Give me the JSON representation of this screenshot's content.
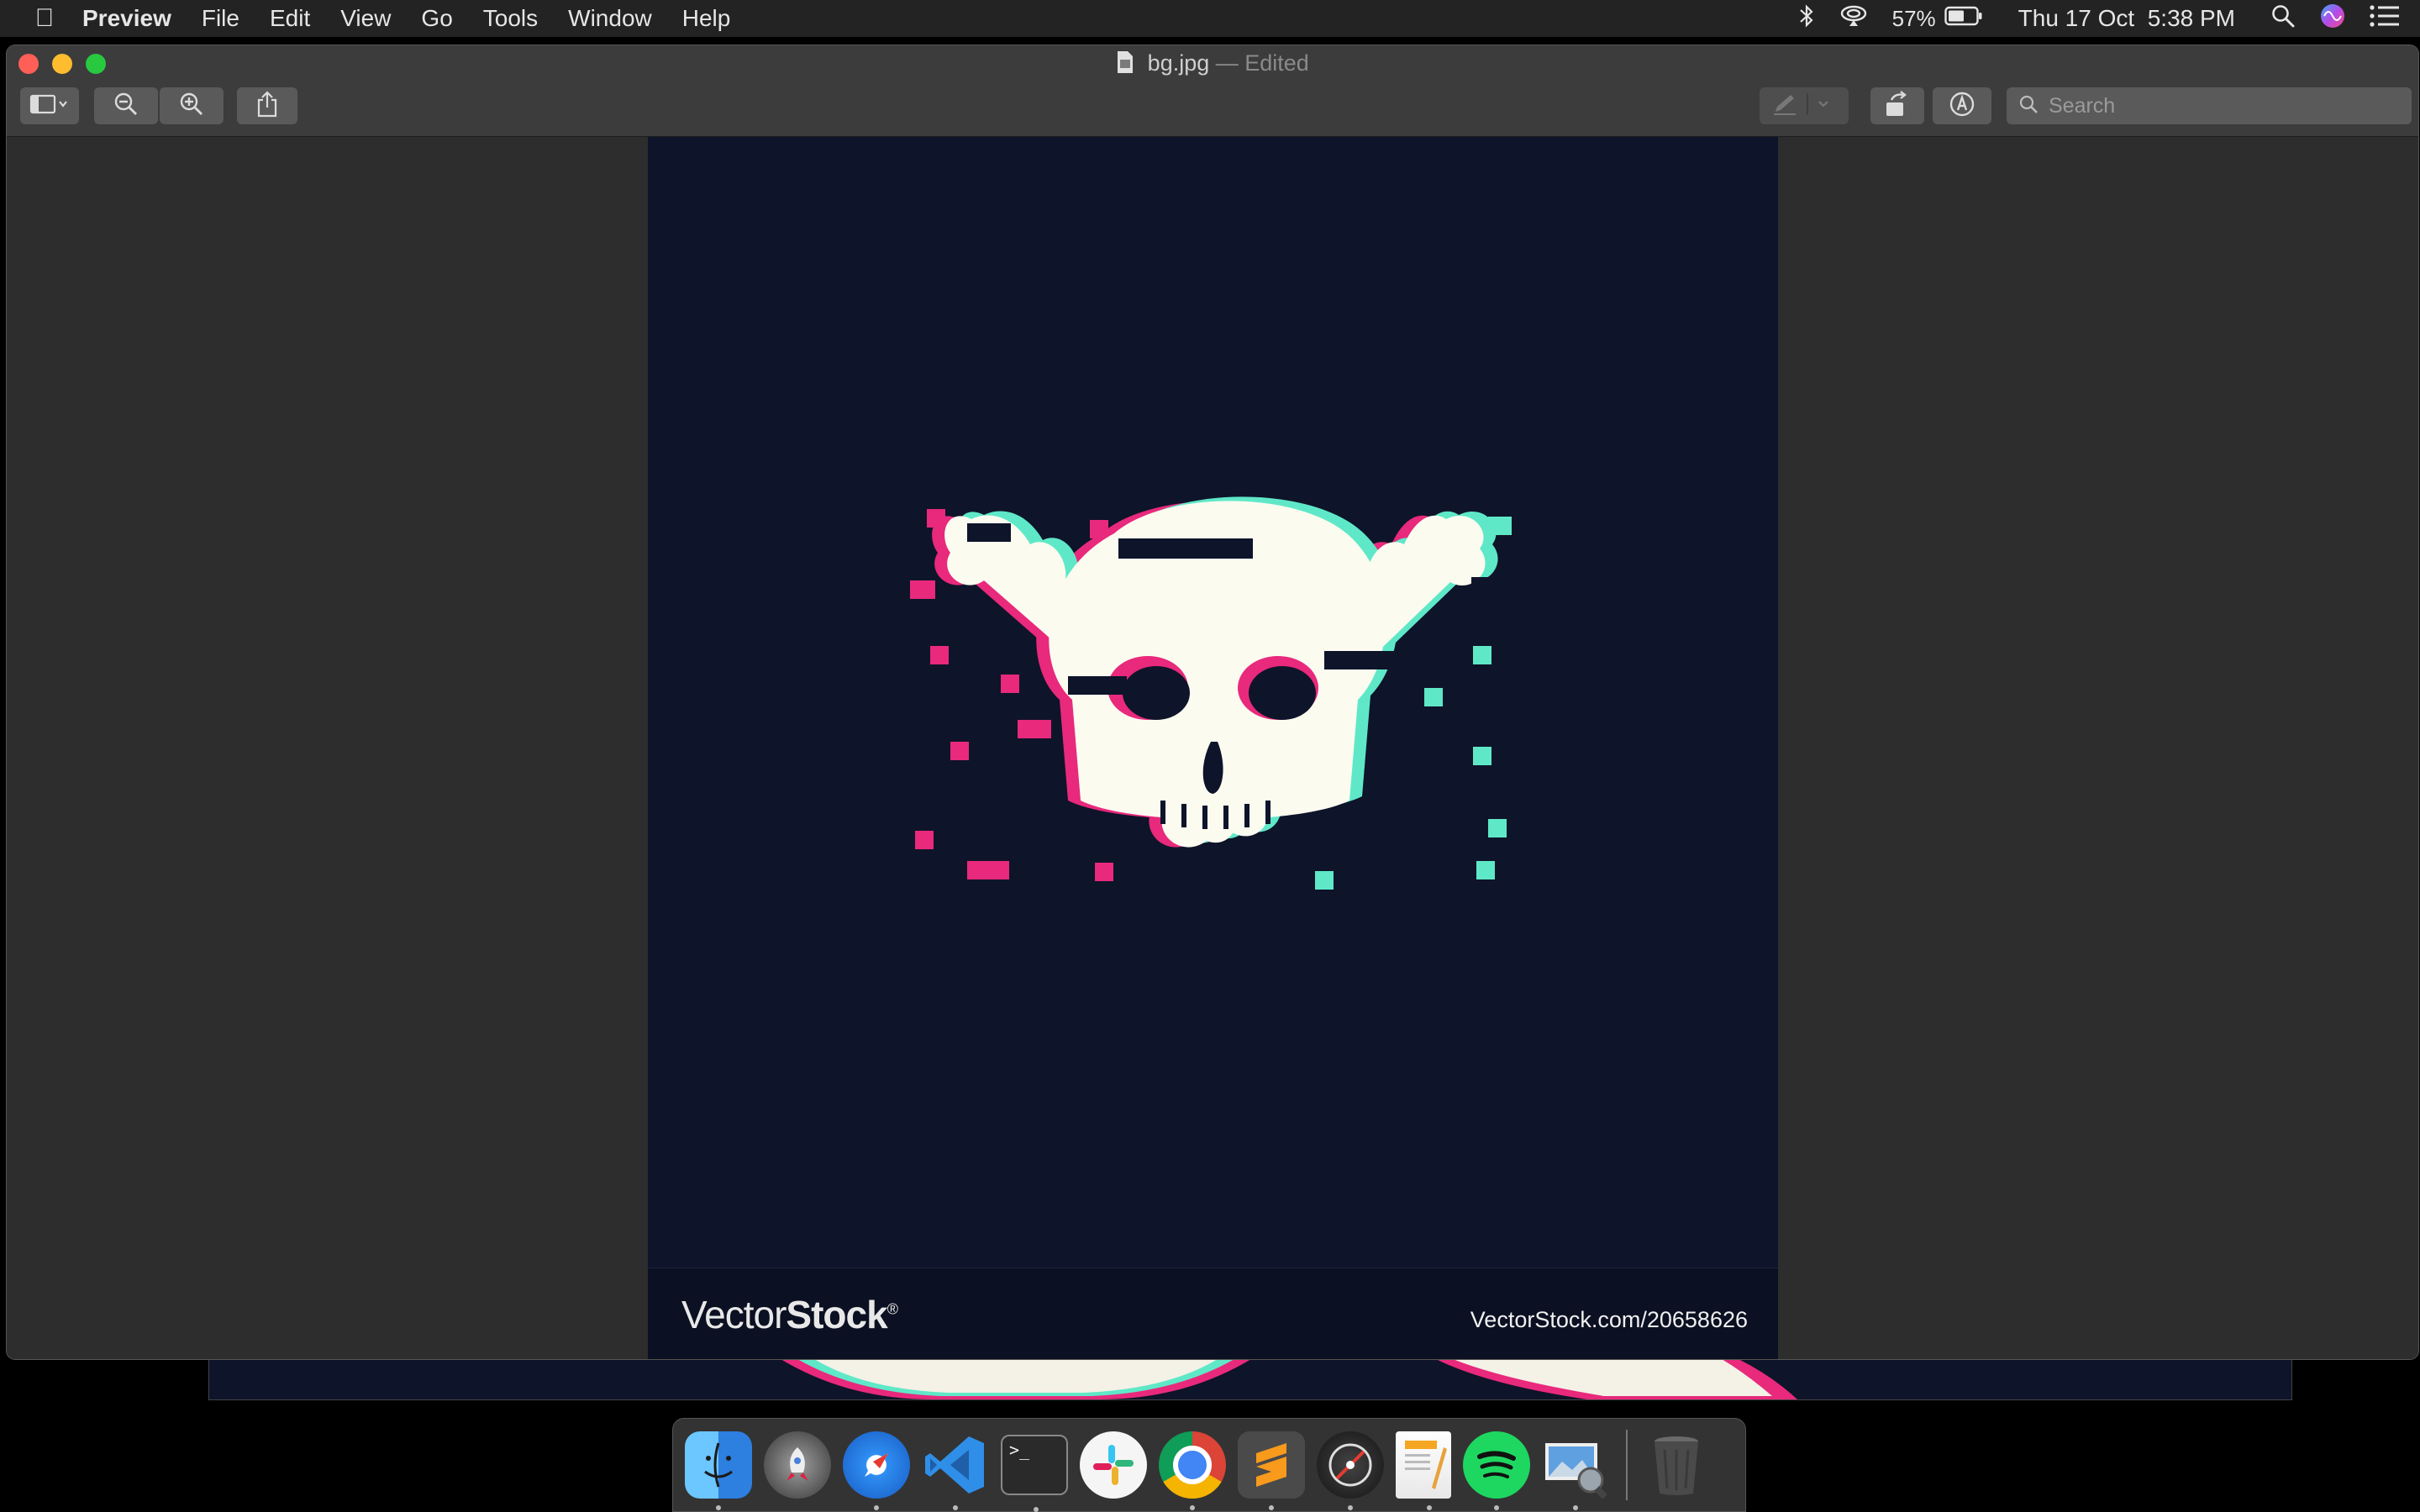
{
  "menubar": {
    "apple_icon": "apple-logo-icon",
    "app_name": "Preview",
    "items": [
      "File",
      "Edit",
      "View",
      "Go",
      "Tools",
      "Window",
      "Help"
    ],
    "battery_percent": "57%",
    "datetime": "Thu 17 Oct  5:38 PM"
  },
  "window": {
    "filename": "bg.jpg",
    "title_suffix": "— Edited",
    "search_placeholder": "Search"
  },
  "image": {
    "brand_light": "Vector",
    "brand_bold": "Stock",
    "brand_mark": "®",
    "url": "VectorStock.com/20658626",
    "background_color": "#0e1429",
    "accent_pink": "#e8297c",
    "accent_teal": "#5fe8c8",
    "skull_color": "#fbfbf0"
  },
  "dock": {
    "apps": [
      "Finder",
      "Launchpad",
      "Safari",
      "Visual Studio Code",
      "Terminal",
      "Slack",
      "Google Chrome",
      "Sublime Text",
      "Digital Color Meter",
      "Pages",
      "Spotify",
      "Preview",
      "Trash"
    ]
  }
}
